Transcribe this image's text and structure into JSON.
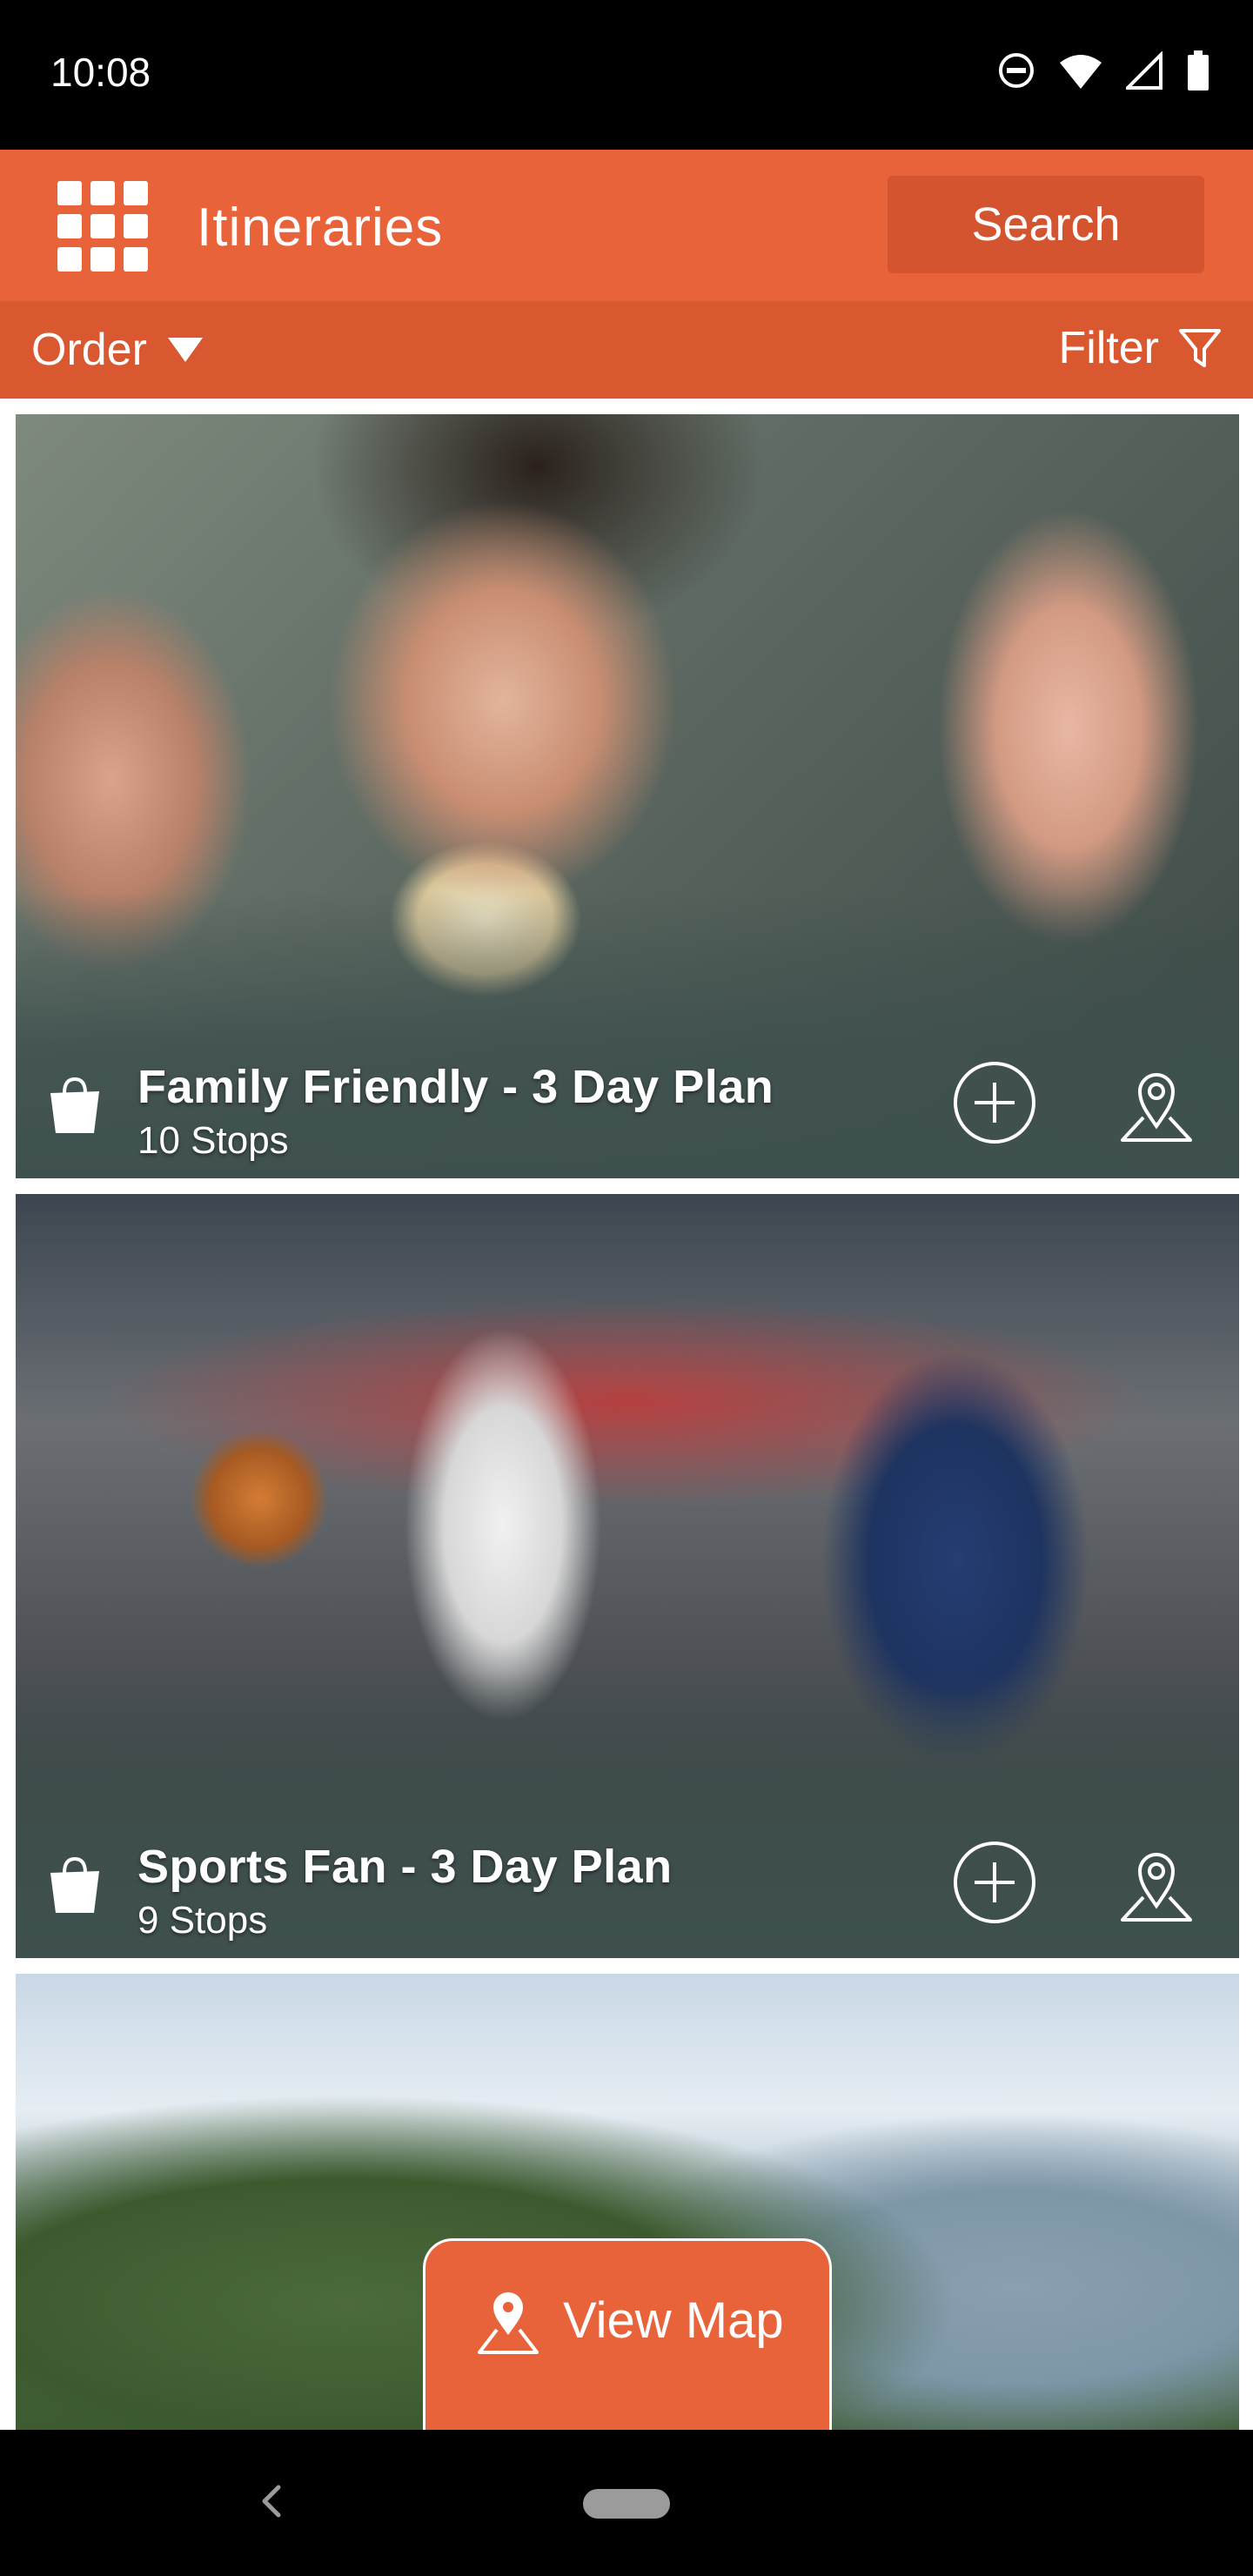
{
  "status_bar": {
    "time": "10:08",
    "icons": [
      "do-not-disturb-icon",
      "wifi-icon",
      "signal-icon",
      "battery-icon"
    ]
  },
  "app_bar": {
    "title": "Itineraries",
    "menu_icon": "grid-menu-icon",
    "search_label": "Search",
    "color": "#e8633a"
  },
  "toolbar": {
    "order_label": "Order",
    "filter_label": "Filter",
    "color": "#d9582f"
  },
  "itineraries": [
    {
      "title": "Family Friendly - 3 Day Plan",
      "stops": "10 Stops"
    },
    {
      "title": "Sports Fan - 3 Day Plan",
      "stops": "9 Stops"
    }
  ],
  "view_map": {
    "label": "View Map"
  },
  "nav_bar": {
    "icons": [
      "back-icon",
      "home-pill"
    ]
  }
}
